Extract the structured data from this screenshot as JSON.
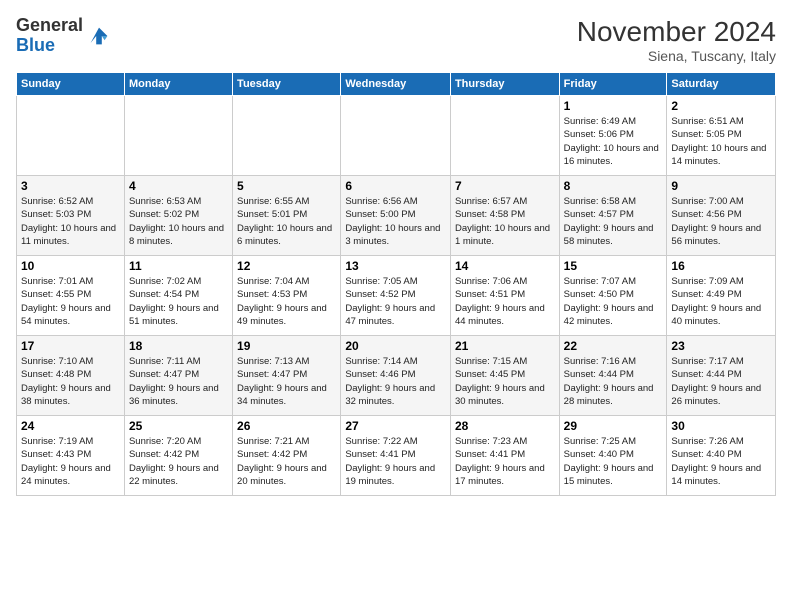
{
  "logo": {
    "line1": "General",
    "line2": "Blue"
  },
  "title": "November 2024",
  "location": "Siena, Tuscany, Italy",
  "weekdays": [
    "Sunday",
    "Monday",
    "Tuesday",
    "Wednesday",
    "Thursday",
    "Friday",
    "Saturday"
  ],
  "weeks": [
    [
      {
        "day": "",
        "info": ""
      },
      {
        "day": "",
        "info": ""
      },
      {
        "day": "",
        "info": ""
      },
      {
        "day": "",
        "info": ""
      },
      {
        "day": "",
        "info": ""
      },
      {
        "day": "1",
        "info": "Sunrise: 6:49 AM\nSunset: 5:06 PM\nDaylight: 10 hours and 16 minutes."
      },
      {
        "day": "2",
        "info": "Sunrise: 6:51 AM\nSunset: 5:05 PM\nDaylight: 10 hours and 14 minutes."
      }
    ],
    [
      {
        "day": "3",
        "info": "Sunrise: 6:52 AM\nSunset: 5:03 PM\nDaylight: 10 hours and 11 minutes."
      },
      {
        "day": "4",
        "info": "Sunrise: 6:53 AM\nSunset: 5:02 PM\nDaylight: 10 hours and 8 minutes."
      },
      {
        "day": "5",
        "info": "Sunrise: 6:55 AM\nSunset: 5:01 PM\nDaylight: 10 hours and 6 minutes."
      },
      {
        "day": "6",
        "info": "Sunrise: 6:56 AM\nSunset: 5:00 PM\nDaylight: 10 hours and 3 minutes."
      },
      {
        "day": "7",
        "info": "Sunrise: 6:57 AM\nSunset: 4:58 PM\nDaylight: 10 hours and 1 minute."
      },
      {
        "day": "8",
        "info": "Sunrise: 6:58 AM\nSunset: 4:57 PM\nDaylight: 9 hours and 58 minutes."
      },
      {
        "day": "9",
        "info": "Sunrise: 7:00 AM\nSunset: 4:56 PM\nDaylight: 9 hours and 56 minutes."
      }
    ],
    [
      {
        "day": "10",
        "info": "Sunrise: 7:01 AM\nSunset: 4:55 PM\nDaylight: 9 hours and 54 minutes."
      },
      {
        "day": "11",
        "info": "Sunrise: 7:02 AM\nSunset: 4:54 PM\nDaylight: 9 hours and 51 minutes."
      },
      {
        "day": "12",
        "info": "Sunrise: 7:04 AM\nSunset: 4:53 PM\nDaylight: 9 hours and 49 minutes."
      },
      {
        "day": "13",
        "info": "Sunrise: 7:05 AM\nSunset: 4:52 PM\nDaylight: 9 hours and 47 minutes."
      },
      {
        "day": "14",
        "info": "Sunrise: 7:06 AM\nSunset: 4:51 PM\nDaylight: 9 hours and 44 minutes."
      },
      {
        "day": "15",
        "info": "Sunrise: 7:07 AM\nSunset: 4:50 PM\nDaylight: 9 hours and 42 minutes."
      },
      {
        "day": "16",
        "info": "Sunrise: 7:09 AM\nSunset: 4:49 PM\nDaylight: 9 hours and 40 minutes."
      }
    ],
    [
      {
        "day": "17",
        "info": "Sunrise: 7:10 AM\nSunset: 4:48 PM\nDaylight: 9 hours and 38 minutes."
      },
      {
        "day": "18",
        "info": "Sunrise: 7:11 AM\nSunset: 4:47 PM\nDaylight: 9 hours and 36 minutes."
      },
      {
        "day": "19",
        "info": "Sunrise: 7:13 AM\nSunset: 4:47 PM\nDaylight: 9 hours and 34 minutes."
      },
      {
        "day": "20",
        "info": "Sunrise: 7:14 AM\nSunset: 4:46 PM\nDaylight: 9 hours and 32 minutes."
      },
      {
        "day": "21",
        "info": "Sunrise: 7:15 AM\nSunset: 4:45 PM\nDaylight: 9 hours and 30 minutes."
      },
      {
        "day": "22",
        "info": "Sunrise: 7:16 AM\nSunset: 4:44 PM\nDaylight: 9 hours and 28 minutes."
      },
      {
        "day": "23",
        "info": "Sunrise: 7:17 AM\nSunset: 4:44 PM\nDaylight: 9 hours and 26 minutes."
      }
    ],
    [
      {
        "day": "24",
        "info": "Sunrise: 7:19 AM\nSunset: 4:43 PM\nDaylight: 9 hours and 24 minutes."
      },
      {
        "day": "25",
        "info": "Sunrise: 7:20 AM\nSunset: 4:42 PM\nDaylight: 9 hours and 22 minutes."
      },
      {
        "day": "26",
        "info": "Sunrise: 7:21 AM\nSunset: 4:42 PM\nDaylight: 9 hours and 20 minutes."
      },
      {
        "day": "27",
        "info": "Sunrise: 7:22 AM\nSunset: 4:41 PM\nDaylight: 9 hours and 19 minutes."
      },
      {
        "day": "28",
        "info": "Sunrise: 7:23 AM\nSunset: 4:41 PM\nDaylight: 9 hours and 17 minutes."
      },
      {
        "day": "29",
        "info": "Sunrise: 7:25 AM\nSunset: 4:40 PM\nDaylight: 9 hours and 15 minutes."
      },
      {
        "day": "30",
        "info": "Sunrise: 7:26 AM\nSunset: 4:40 PM\nDaylight: 9 hours and 14 minutes."
      }
    ]
  ]
}
